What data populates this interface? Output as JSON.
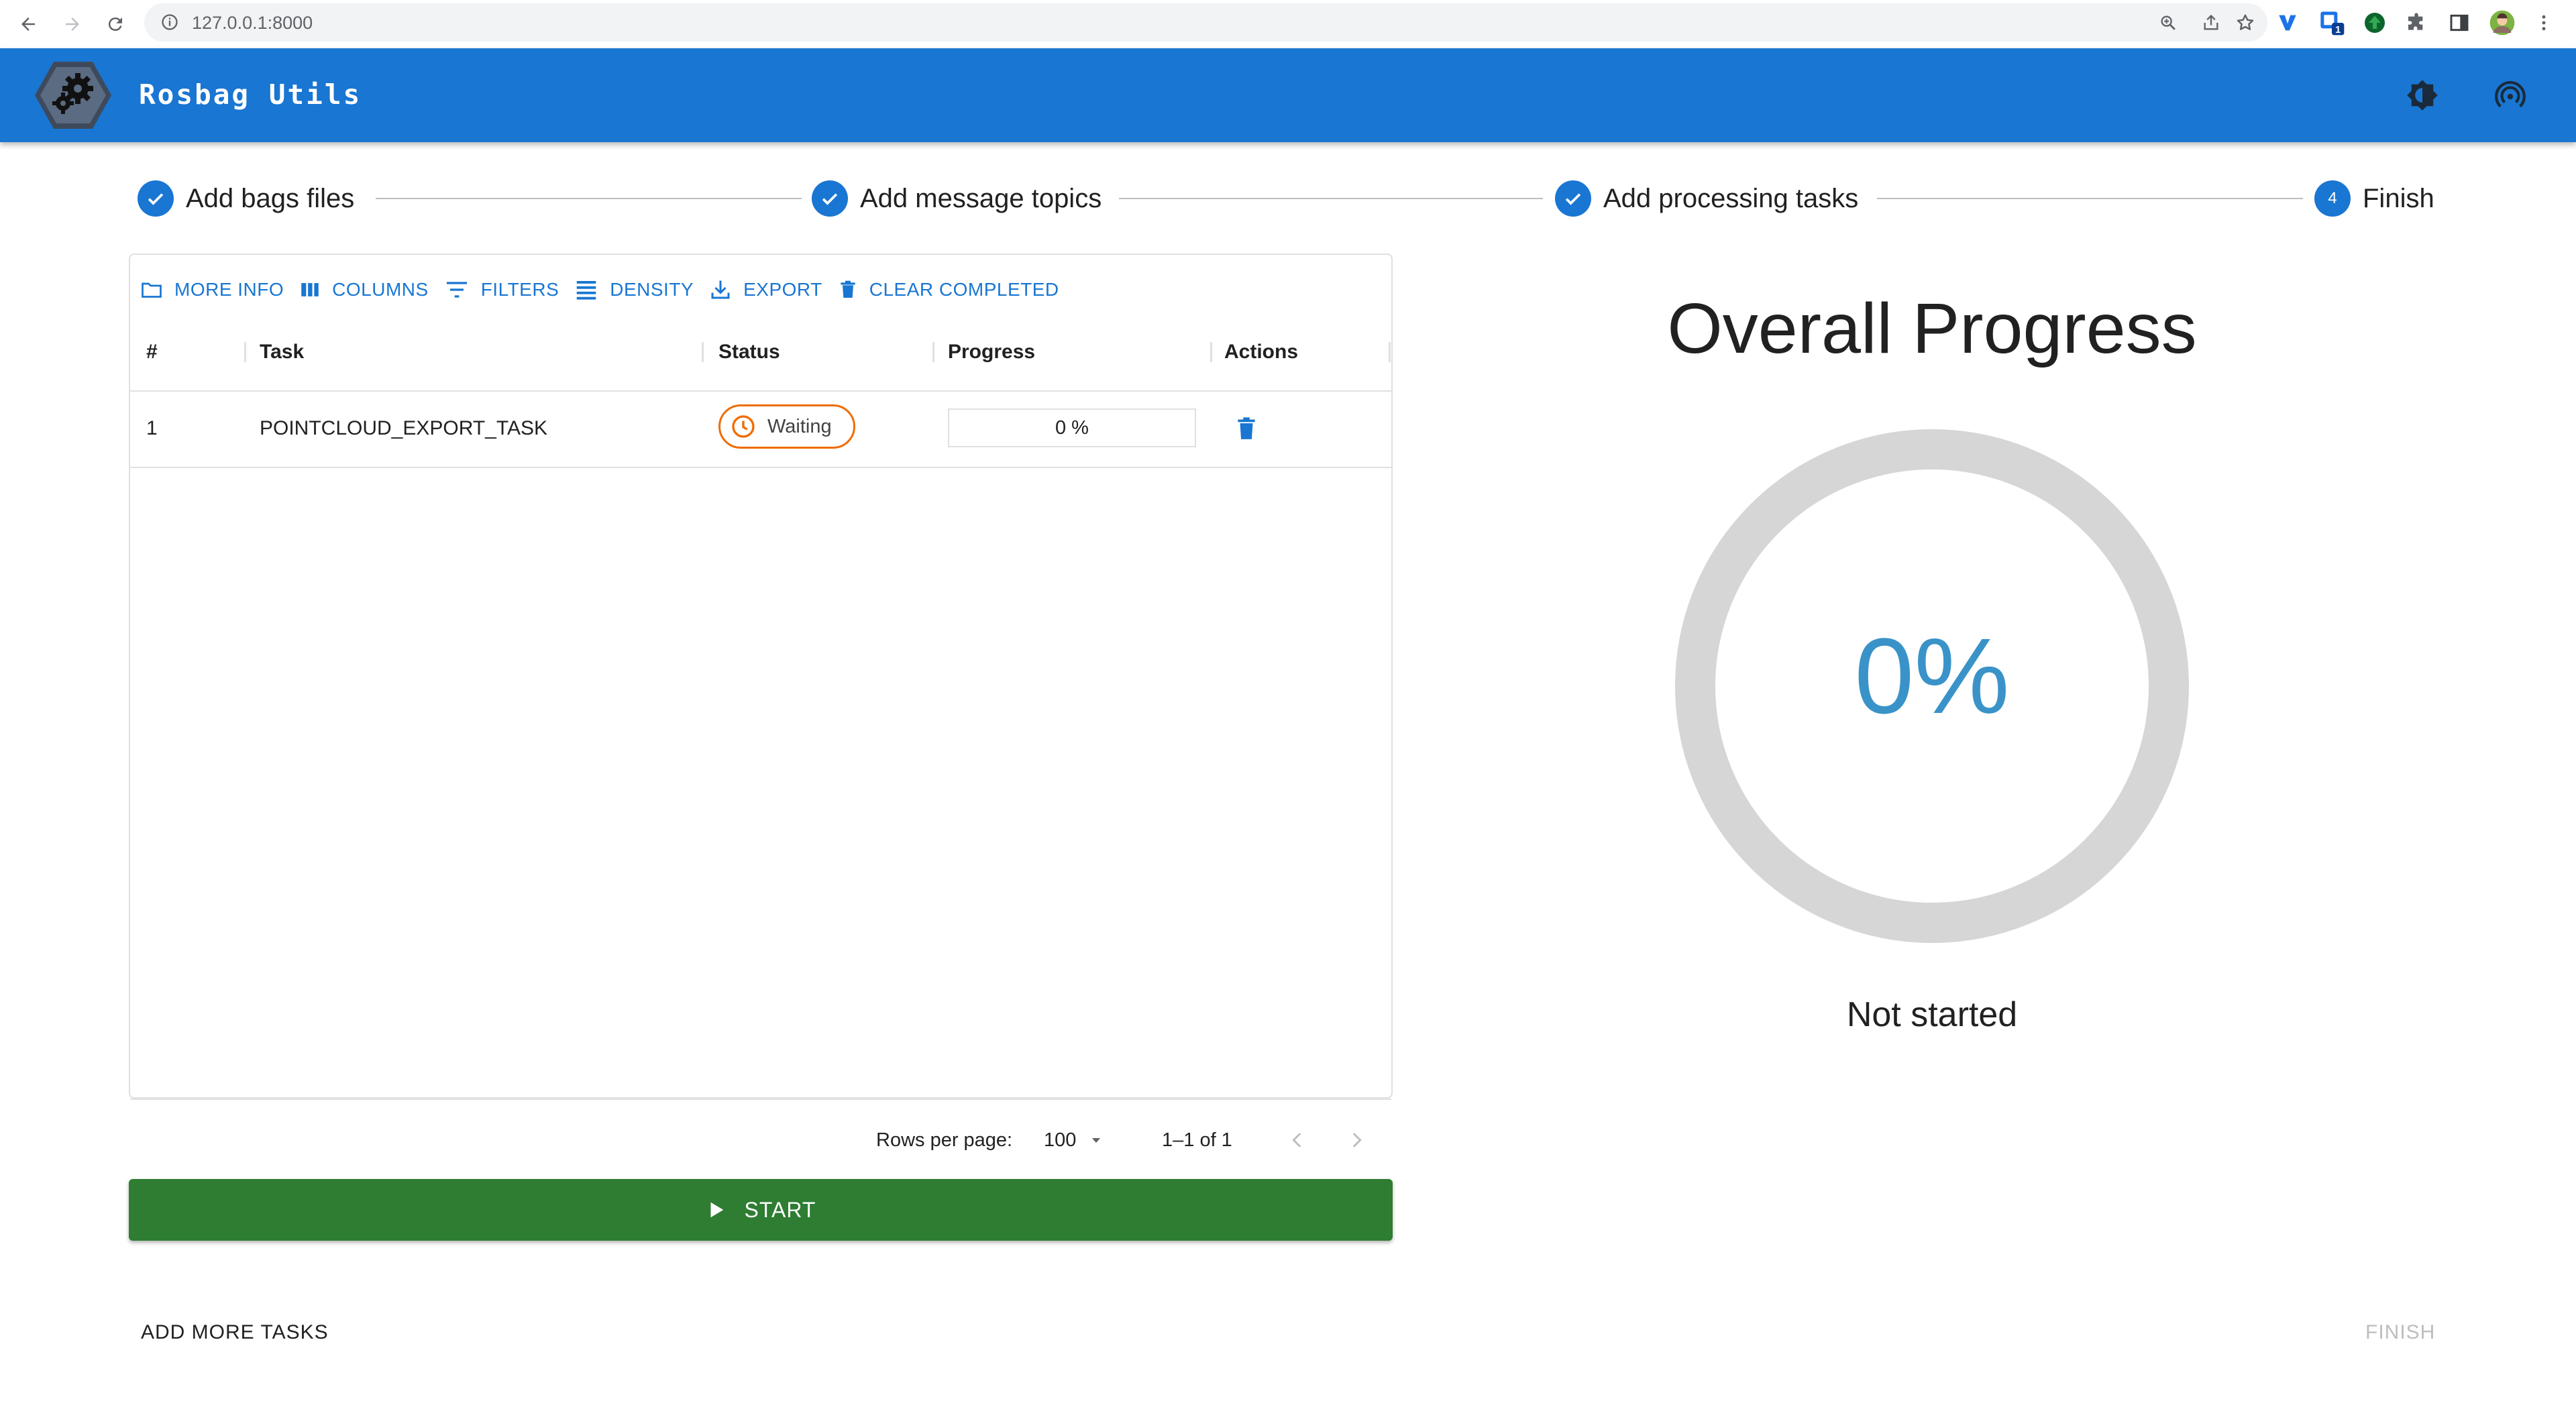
{
  "browser": {
    "url": "127.0.0.1:8000",
    "extension_badge": "1",
    "icons": [
      "back-arrow-icon",
      "forward-arrow-icon",
      "reload-icon",
      "info-icon",
      "zoom-icon",
      "share-icon",
      "star-icon",
      "vimium-extension-icon",
      "extension-icon",
      "puzzle-icon",
      "sidebar-icon",
      "profile-avatar",
      "menu-dots-icon"
    ]
  },
  "app": {
    "title": "Rosbag Utils",
    "brand_color": "#1976d2"
  },
  "stepper": {
    "steps": [
      {
        "label": "Add bags files",
        "state": "completed"
      },
      {
        "label": "Add message topics",
        "state": "completed"
      },
      {
        "label": "Add processing tasks",
        "state": "completed"
      },
      {
        "label": "Finish",
        "state": "active",
        "number": "4"
      }
    ]
  },
  "toolbar": {
    "more_info": "MORE INFO",
    "columns": "COLUMNS",
    "filters": "FILTERS",
    "density": "DENSITY",
    "export": "EXPORT",
    "clear_completed": "CLEAR COMPLETED"
  },
  "table": {
    "columns": [
      "#",
      "Task",
      "Status",
      "Progress",
      "Actions"
    ],
    "rows": [
      {
        "index": "1",
        "task": "POINTCLOUD_EXPORT_TASK",
        "status": "Waiting",
        "status_color": "#ef6c00",
        "progress": "0 %"
      }
    ]
  },
  "pagination": {
    "rows_per_page_label": "Rows per page:",
    "rows_per_page": "100",
    "range": "1–1 of 1"
  },
  "start_button": "START",
  "start_color": "#2e7d32",
  "add_more_tasks": "ADD MORE TASKS",
  "finish": "FINISH",
  "overall": {
    "title": "Overall Progress",
    "percent_label": "0%",
    "percent_value": 0,
    "status": "Not started",
    "accent_color": "#3a93c8"
  }
}
